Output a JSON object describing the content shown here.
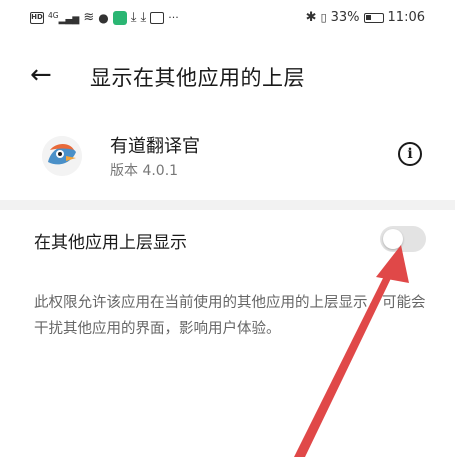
{
  "status_bar": {
    "left_icons": [
      "hd-icon",
      "signal-icon",
      "wifi-icon",
      "app-notify-icon",
      "app-green-icon",
      "download-icon",
      "download-icon",
      "app-box-icon",
      "more-icon"
    ],
    "signal_label": "4G",
    "hd_label": "HD",
    "more_label": "···",
    "battery_percent": "33%",
    "time": "11:06"
  },
  "header": {
    "title": "显示在其他应用的上层"
  },
  "app": {
    "name": "有道翻译官",
    "version": "版本 4.0.1"
  },
  "setting": {
    "label": "在其他应用上层显示",
    "enabled": false,
    "description": "此权限允许该应用在当前使用的其他应用的上层显示，可能会干扰其他应用的界面，影响用户体验。"
  },
  "colors": {
    "arrow": "#e04848",
    "toggle_off": "#e3e3e3",
    "divider": "#f2f2f2"
  }
}
